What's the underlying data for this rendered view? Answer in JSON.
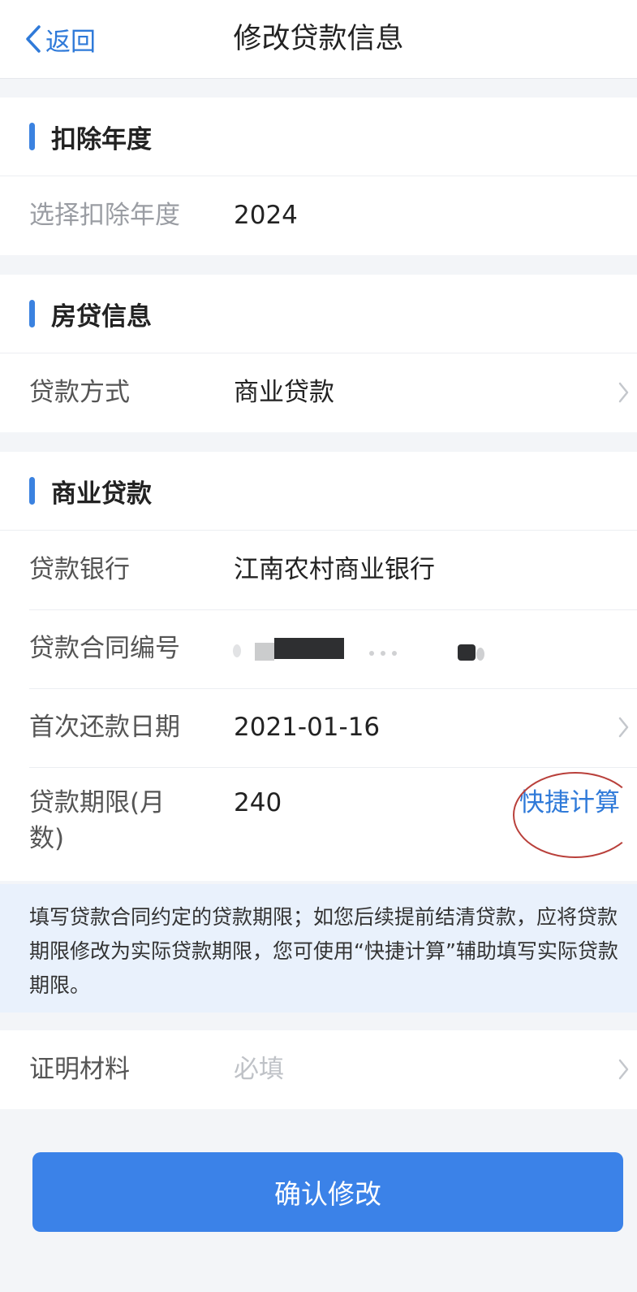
{
  "nav": {
    "back_label": "返回",
    "title": "修改贷款信息"
  },
  "deduction_year": {
    "section_title": "扣除年度",
    "select_label": "选择扣除年度",
    "select_value": "2024"
  },
  "mortgage_info": {
    "section_title": "房贷信息",
    "loan_type_label": "贷款方式",
    "loan_type_value": "商业贷款"
  },
  "commercial_loan": {
    "section_title": "商业贷款",
    "bank_label": "贷款银行",
    "bank_value": "江南农村商业银行",
    "contract_label": "贷款合同编号",
    "first_payment_label": "首次还款日期",
    "first_payment_value": "2021-01-16",
    "term_label": "贷款期限(月数)",
    "term_value": "240",
    "quick_calc_label": "快捷计算"
  },
  "notice": {
    "text": "填写贷款合同约定的贷款期限；如您后续提前结清贷款，应将贷款期限修改为实际贷款期限，您可使用“快捷计算”辅助填写实际贷款期限。"
  },
  "proof": {
    "label": "证明材料",
    "placeholder": "必填"
  },
  "actions": {
    "confirm_label": "确认修改"
  },
  "colors": {
    "accent": "#2f7ad9",
    "button": "#3b82e8",
    "notice_bg": "#e9f1fc",
    "annotation_circle": "#b9403b"
  }
}
